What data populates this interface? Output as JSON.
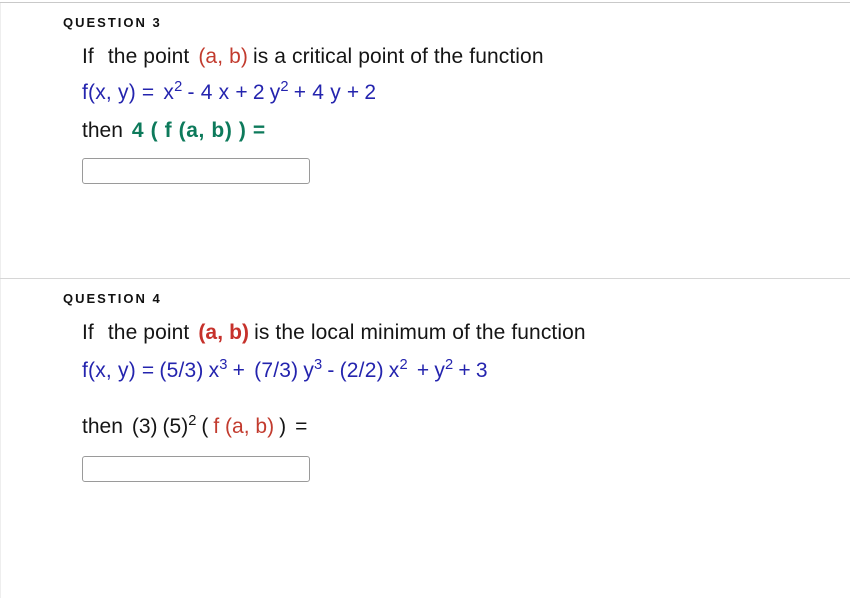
{
  "page": {
    "background_color": "#ffffff",
    "text_color": "#151515",
    "divider_color": "#d6d6d6",
    "accent_colors": {
      "formula_blue": "#2424ae",
      "point_red": "#c23b2e",
      "point_red_bold": "#c6312b",
      "expression_teal": "#0d7a5b"
    }
  },
  "questions": [
    {
      "header": "QUESTION 3",
      "prose": {
        "lead": "If",
        "phrase_before": "the point",
        "point": "(a, b)",
        "phrase_after": "is a critical point of the function"
      },
      "formula": {
        "lhs": "f(x, y) =",
        "t1_base": "x",
        "t1_exp": "2",
        "t2": "- 4 x +",
        "t3_coef": "2",
        "t3_base": "y",
        "t3_exp": "2",
        "t4": "+ 4 y +",
        "t5": "2"
      },
      "then": {
        "label": "then",
        "expression": "4 ( f (a, b) ) ="
      },
      "answer": {
        "value": "",
        "placeholder": ""
      }
    },
    {
      "header": "QUESTION 4",
      "prose": {
        "lead": "If",
        "phrase_before": "the point",
        "point": "(a, b)",
        "phrase_after": "is  the local minimum of the function"
      },
      "formula": {
        "lhs": "f(x, y) =",
        "t1_coef": "(5/3)",
        "t1_base": "x",
        "t1_exp": "3",
        "op1": "+",
        "t2_coef": "(7/3)",
        "t2_base": "y",
        "t2_exp": "3",
        "op2": "-",
        "t3_coef": "(2/2)",
        "t3_base": "x",
        "t3_exp": "2",
        "op3": "+",
        "t4_base": "y",
        "t4_exp": "2",
        "op4": "+",
        "t5": "3"
      },
      "then": {
        "label": "then",
        "coef1": "(3)",
        "coef2_base": "(5)",
        "coef2_exp": "2",
        "open_paren": "(",
        "point_expr": "f (a, b)",
        "close_paren": ")",
        "equals": "="
      },
      "answer": {
        "value": "",
        "placeholder": ""
      }
    }
  ]
}
